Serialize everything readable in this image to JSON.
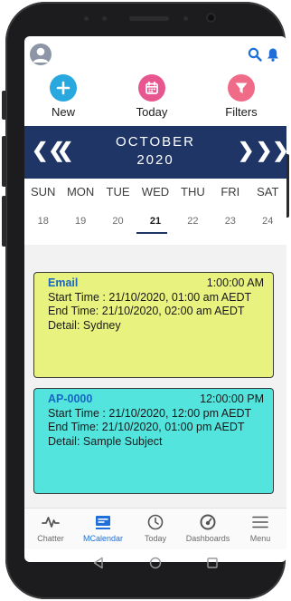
{
  "colors": {
    "header": "#1e3566",
    "accent_blue": "#1e6fd9",
    "new_button": "#29a8e0",
    "today_button": "#e8568f",
    "filters_button": "#f06b87",
    "event_email_bg": "#e8f27f",
    "event_ap_bg": "#52e4dd"
  },
  "topbar": {
    "avatar_icon": "user-avatar",
    "search_icon": "search-icon",
    "bell_icon": "bell-icon"
  },
  "actions": [
    {
      "label": "New",
      "icon": "plus-icon"
    },
    {
      "label": "Today",
      "icon": "calendar-icon"
    },
    {
      "label": "Filters",
      "icon": "filter-icon"
    }
  ],
  "calendar": {
    "month": "OCTOBER",
    "year": "2020",
    "prev_double": "❮❮",
    "prev_single": "❮",
    "next_single": "❯",
    "next_double": "❯❯",
    "weekdays": [
      "SUN",
      "MON",
      "TUE",
      "WED",
      "THU",
      "FRI",
      "SAT"
    ],
    "dates": [
      "18",
      "19",
      "20",
      "21",
      "22",
      "23",
      "24"
    ],
    "selected_date": "21"
  },
  "events": [
    {
      "title": "Email",
      "time": "1:00:00 AM",
      "start": "Start Time : 21/10/2020, 01:00 am AEDT",
      "end": "End Time: 21/10/2020, 02:00 am AEDT",
      "detail": "Detail: Sydney"
    },
    {
      "title": "AP-0000",
      "time": "12:00:00 PM",
      "start": "Start Time : 21/10/2020, 12:00 pm AEDT",
      "end": "End Time: 21/10/2020, 01:00 pm AEDT",
      "detail": "Detail: Sample Subject"
    }
  ],
  "bottom_nav": [
    {
      "label": "Chatter",
      "icon": "chatter-icon"
    },
    {
      "label": "MCalendar",
      "icon": "mcalendar-icon",
      "active": true
    },
    {
      "label": "Today",
      "icon": "clock-icon"
    },
    {
      "label": "Dashboards",
      "icon": "gauge-icon"
    },
    {
      "label": "Menu",
      "icon": "menu-icon"
    }
  ]
}
